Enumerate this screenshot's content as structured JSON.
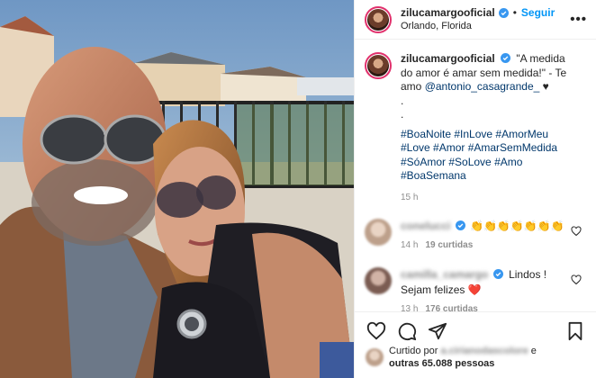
{
  "header": {
    "username": "zilucamargooficial",
    "separator": "•",
    "follow_label": "Seguir",
    "location": "Orlando, Florida",
    "more_label": "•••"
  },
  "caption": {
    "username": "zilucamargooficial",
    "text": "\"A medida do amor é amar sem medida!\" - Te amo",
    "mention": "@antonio_casagrande_",
    "after_mention": "♥",
    "dot1": ".",
    "dot2": ".",
    "hashtags": "#BoaNoite #InLove #AmorMeu #Love #Amor #AmarSemMedida #SóAmor #SoLove #Amo #BoaSemana",
    "time": "15 h"
  },
  "comments": [
    {
      "username": "conelucci",
      "text": "👏👏👏👏👏👏👏",
      "time": "14 h",
      "likes": "19 curtidas"
    },
    {
      "username": "camilla_camargo",
      "text": "Lindos !",
      "text2": "Sejam felizes",
      "emoji": "❤️",
      "time": "13 h",
      "likes": "176 curtidas"
    }
  ],
  "likes": {
    "prefix": "Curtido por",
    "blurred_user": "a.cirianodascolore",
    "and": "e",
    "others": "outras 65.088 pessoas"
  },
  "colors": {
    "accent": "#0095f6",
    "verified": "#3897f0",
    "link": "#00376b",
    "muted": "#8e8e8e",
    "heart_red": "#ed4956"
  },
  "icons": {
    "verified": "verified-badge-icon",
    "like": "heart-icon",
    "comment": "comment-icon",
    "share": "send-icon",
    "save": "bookmark-icon"
  }
}
